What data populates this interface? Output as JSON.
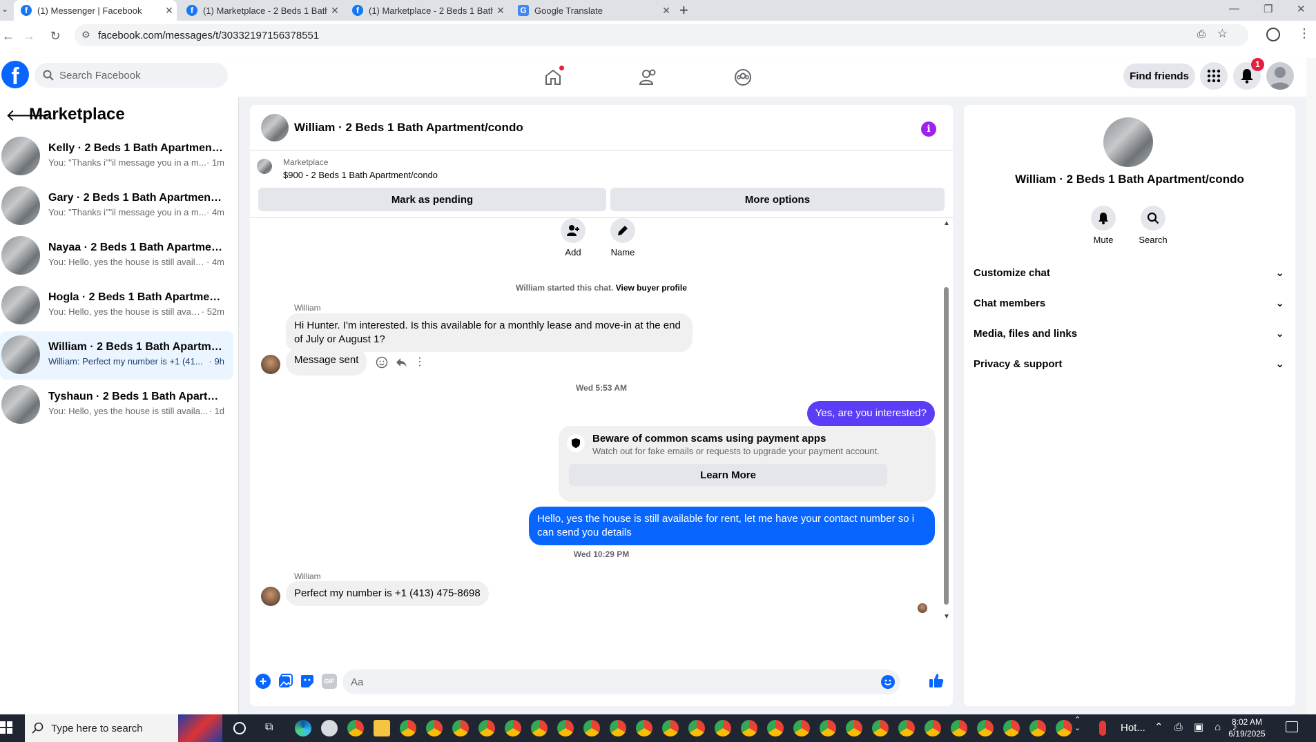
{
  "browser": {
    "tabs": [
      {
        "title": "(1) Messenger | Facebook",
        "icon": "facebook-icon",
        "active": true
      },
      {
        "title": "(1) Marketplace - 2 Beds 1 Bath",
        "icon": "facebook-icon",
        "active": false
      },
      {
        "title": "(1) Marketplace - 2 Beds 1 Bath",
        "icon": "facebook-icon",
        "active": false
      },
      {
        "title": "Google Translate",
        "icon": "google-translate-icon",
        "active": false
      }
    ],
    "new_tab": "+",
    "url": "facebook.com/messages/t/30332197156378551"
  },
  "header": {
    "logo": "f",
    "search_placeholder": "Search Facebook",
    "find_friends": "Find friends",
    "notification_count": "1"
  },
  "sidebar": {
    "title": "Marketplace",
    "conversations": [
      {
        "name": "Kelly · 2 Beds 1 Bath Apartment/co...",
        "preview": "You: \"Thanks i\"\"il message you in a m...",
        "time": "· 1m",
        "selected": false
      },
      {
        "name": "Gary · 2 Beds 1 Bath Apartment/co...",
        "preview": "You: \"Thanks i\"\"il message you in a m...",
        "time": "· 4m",
        "selected": false
      },
      {
        "name": "Nayaa · 2 Beds 1 Bath Apartment/c...",
        "preview": "You: Hello, yes the house is still availa...",
        "time": "· 4m",
        "selected": false
      },
      {
        "name": "Hogla · 2 Beds 1 Bath Apartment/c...",
        "preview": "You: Hello, yes the house is still avail...",
        "time": "· 52m",
        "selected": false
      },
      {
        "name": "William · 2 Beds 1 Bath Apartment...",
        "preview": "William: Perfect my number is +1 (41...",
        "time": "· 9h",
        "selected": true
      },
      {
        "name": "Tyshaun · 2 Beds 1 Bath Apartment...",
        "preview": "You: Hello, yes the house is still availa...",
        "time": "· 1d",
        "selected": false
      }
    ]
  },
  "chat": {
    "title": "William · 2 Beds 1 Bath Apartment/condo",
    "marketplace_label": "Marketplace",
    "listing": "$900 - 2 Beds 1 Bath Apartment/condo",
    "mark_pending": "Mark as pending",
    "more_options": "More options",
    "add_label": "Add",
    "name_label": "Name",
    "started_text": "William started this chat.",
    "view_profile": "View buyer profile",
    "sender_name": "William",
    "msg1": "Hi Hunter. I'm interested. Is this available for a monthly lease and move-in at the end of July or August 1?",
    "msg2": "Message sent",
    "stamp1": "Wed 5:53 AM",
    "msg3": "Yes, are you interested?",
    "scam_title": "Beware of common scams using payment apps",
    "scam_body": "Watch out for fake emails or requests to upgrade your payment account.",
    "learn_more": "Learn More",
    "msg4": "Hello, yes the house is still available for rent, let me have your contact number so i can send you details",
    "stamp2": "Wed 10:29 PM",
    "sender_name2": "William",
    "msg5": "Perfect my number is +1 (413) 475-8698",
    "composer_placeholder": "Aa",
    "accent": "#0866ff"
  },
  "info_panel": {
    "title": "William · 2 Beds 1 Bath Apartment/condo",
    "mute": "Mute",
    "search": "Search",
    "sections": [
      "Customize chat",
      "Chat members",
      "Media, files and links",
      "Privacy & support"
    ]
  },
  "taskbar": {
    "search_placeholder": "Type here to search",
    "weather": "Hot...",
    "time": "8:02 AM",
    "date": "6/19/2025"
  }
}
